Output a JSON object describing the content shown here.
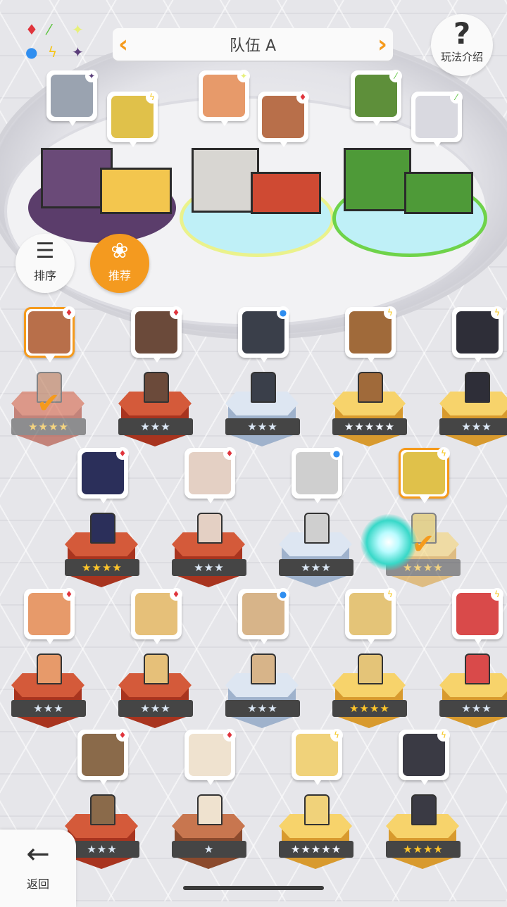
{
  "header": {
    "team_name": "队伍 A",
    "left_arrow": "‹",
    "right_arrow": "›",
    "help_icon": "?",
    "help_label": "玩法介绍"
  },
  "element_chart": {
    "symbols": [
      "♦",
      "⁄",
      "✦",
      "●",
      "ϟ",
      "✦"
    ],
    "colors": [
      "#e0343c",
      "#5ac23b",
      "#e7f07a",
      "#2f8ef0",
      "#f5c518",
      "#5a3d7a"
    ]
  },
  "buttons": {
    "sort_icon": "☰",
    "sort_label": "排序",
    "recommend_icon": "❀",
    "recommend_label": "推荐",
    "back_icon": "←",
    "back_label": "返回"
  },
  "team_slots": [
    {
      "element": "dark",
      "badge": "✦",
      "badge_color": "#5a3d7a",
      "face_color": "#9aa3b0"
    },
    {
      "element": "light",
      "badge": "ϟ",
      "badge_color": "#f5c518",
      "face_color": "#e0c14a"
    },
    {
      "element": "wind",
      "badge": "✦",
      "badge_color": "#e7f07a",
      "face_color": "#e79a6a"
    },
    {
      "element": "fire",
      "badge": "♦",
      "badge_color": "#e0343c",
      "face_color": "#b86f4a"
    },
    {
      "element": "earth",
      "badge": "⁄",
      "badge_color": "#5ac23b",
      "face_color": "#5e8f3a"
    },
    {
      "element": "earth",
      "badge": "⁄",
      "badge_color": "#5ac23b",
      "face_color": "#d9d9e0"
    }
  ],
  "roster": [
    {
      "stars": "★★★★",
      "star_class": "s-gold",
      "ped": "red",
      "badge": "♦",
      "badge_color": "#e0343c",
      "face_color": "#b86f4a",
      "selected": true
    },
    {
      "stars": "★★★",
      "star_class": "s-silver",
      "ped": "red",
      "badge": "♦",
      "badge_color": "#e0343c",
      "face_color": "#6b4a3a"
    },
    {
      "stars": "★★★",
      "star_class": "s-silver",
      "ped": "blue",
      "badge": "●",
      "badge_color": "#2f8ef0",
      "face_color": "#3a3f4a"
    },
    {
      "stars": "★★★★★",
      "star_class": "s-rain",
      "ped": "gold",
      "badge": "ϟ",
      "badge_color": "#f5c518",
      "face_color": "#a06a3a"
    },
    {
      "stars": "★★★",
      "star_class": "s-silver",
      "ped": "gold",
      "badge": "ϟ",
      "badge_color": "#f5c518",
      "face_color": "#2e2e38"
    },
    {
      "stars": "★★★★",
      "star_class": "s-gold",
      "ped": "red",
      "badge": "♦",
      "badge_color": "#e0343c",
      "face_color": "#2b2f5a"
    },
    {
      "stars": "★★★",
      "star_class": "s-silver",
      "ped": "red",
      "badge": "♦",
      "badge_color": "#e0343c",
      "face_color": "#e4d0c4"
    },
    {
      "stars": "★★★",
      "star_class": "s-silver",
      "ped": "blue",
      "badge": "●",
      "badge_color": "#2f8ef0",
      "face_color": "#cfcfcf"
    },
    {
      "stars": "★★★★",
      "star_class": "s-gold",
      "ped": "gold",
      "badge": "ϟ",
      "badge_color": "#f5c518",
      "face_color": "#e0c14a",
      "selected": true
    },
    {
      "stars": "★★★",
      "star_class": "s-silver",
      "ped": "red",
      "badge": "♦",
      "badge_color": "#e0343c",
      "face_color": "#e79a6a"
    },
    {
      "stars": "★★★",
      "star_class": "s-silver",
      "ped": "red",
      "badge": "♦",
      "badge_color": "#e0343c",
      "face_color": "#e6c079"
    },
    {
      "stars": "★★★",
      "star_class": "s-silver",
      "ped": "blue",
      "badge": "●",
      "badge_color": "#2f8ef0",
      "face_color": "#d7b489"
    },
    {
      "stars": "★★★★",
      "star_class": "s-gold",
      "ped": "gold",
      "badge": "ϟ",
      "badge_color": "#f5c518",
      "face_color": "#e4c478"
    },
    {
      "stars": "★★★",
      "star_class": "s-silver",
      "ped": "gold",
      "badge": "ϟ",
      "badge_color": "#f5c518",
      "face_color": "#d94a4a"
    },
    {
      "stars": "★★★",
      "star_class": "s-silver",
      "ped": "red",
      "badge": "♦",
      "badge_color": "#e0343c",
      "face_color": "#8a6a4a"
    },
    {
      "stars": "★",
      "star_class": "s-silver",
      "ped": "brown",
      "badge": "♦",
      "badge_color": "#e0343c",
      "face_color": "#efe2cf"
    },
    {
      "stars": "★★★★★",
      "star_class": "s-rain",
      "ped": "gold",
      "badge": "ϟ",
      "badge_color": "#f5c518",
      "face_color": "#f0d27a"
    },
    {
      "stars": "★★★★",
      "star_class": "s-gold",
      "ped": "gold",
      "badge": "ϟ",
      "badge_color": "#f5c518",
      "face_color": "#3a3a44"
    }
  ],
  "check_icon": "✔"
}
